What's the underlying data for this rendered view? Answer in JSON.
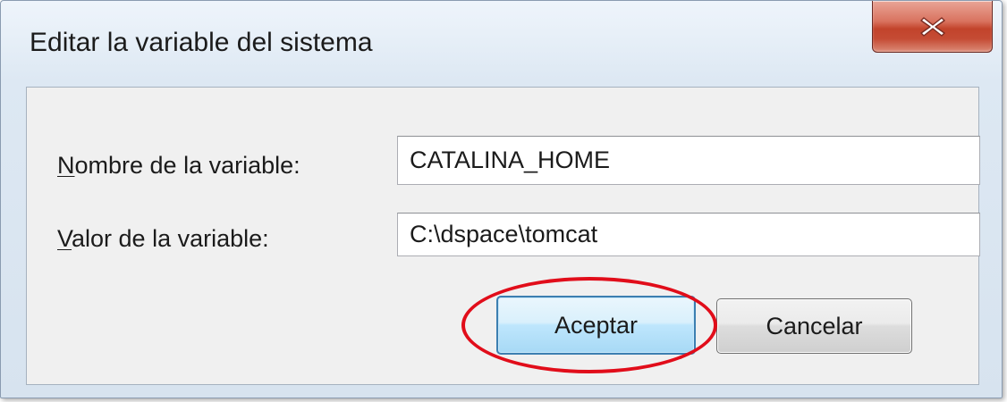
{
  "window": {
    "title": "Editar la variable del sistema",
    "close_icon": "close-x-icon"
  },
  "form": {
    "name_label_accel": "N",
    "name_label_rest": "ombre de la variable:",
    "name_value": "CATALINA_HOME",
    "value_label_accel": "V",
    "value_label_rest": "alor de la variable:",
    "value_value": "C:\\dspace\\tomcat"
  },
  "buttons": {
    "accept_label": "Aceptar",
    "cancel_label": "Cancelar"
  },
  "annotation": {
    "ellipse_color": "#e10d1a"
  },
  "colors": {
    "close_button": "#c2432b",
    "accept_border": "#3c7fb1",
    "text": "#1b1b1b"
  }
}
